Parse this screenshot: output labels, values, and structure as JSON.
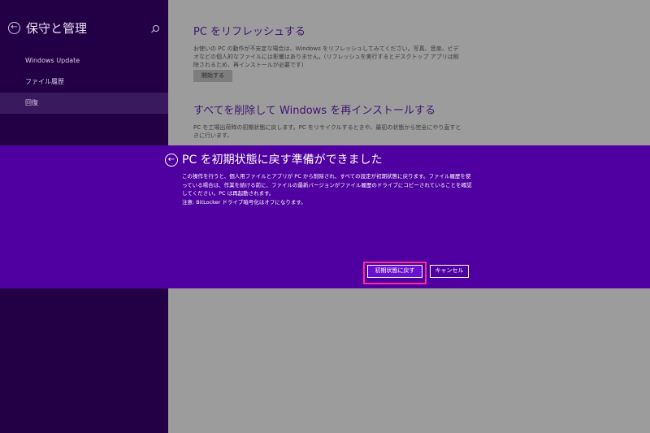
{
  "sidebar": {
    "title": "保守と管理",
    "back_icon": "arrow-left-circle",
    "search_icon": "search-icon",
    "items": [
      {
        "label": "Windows Update"
      },
      {
        "label": "ファイル履歴"
      },
      {
        "label": "回復"
      }
    ],
    "selected_index": 2
  },
  "content": {
    "refresh": {
      "title": "PC をリフレッシュする",
      "description": "お使いの PC の動作が不安定な場合は、Windows をリフレッシュしてみてください。写真、音楽、ビデオなどの個人的なファイルには影響はありません。(リフレッシュを実行するとデスクトップ アプリは削除されるため、再インストールが必要です)",
      "button": "開始する"
    },
    "reset": {
      "title": "すべてを削除して Windows を再インストールする",
      "description": "PC を工場出荷時の初期状態に戻します。PC をリサイクルするときや、最初の状態から完全にやり直すときに行います。"
    }
  },
  "modal": {
    "title": "PC を初期状態に戻す準備ができました",
    "body": "この操作を行うと、個人用ファイルとアプリが PC から削除され、すべての設定が初期状態に戻ります。ファイル履歴を使っている場合は、作業を続ける前に、ファイルの最新バージョンがファイル履歴のドライブにコピーされていることを確認してください。PC は再起動されます。",
    "note": "注意: BitLocker ドライブ暗号化はオフになります。",
    "reset_button": "初期状態に戻す",
    "cancel_button": "キャンセル",
    "highlight_color": "#ff2f98"
  },
  "colors": {
    "sidebar_bg": "#230046",
    "content_bg": "#9c9c9c",
    "modal_bg": "#5000a0",
    "section_title": "#3f1470"
  }
}
